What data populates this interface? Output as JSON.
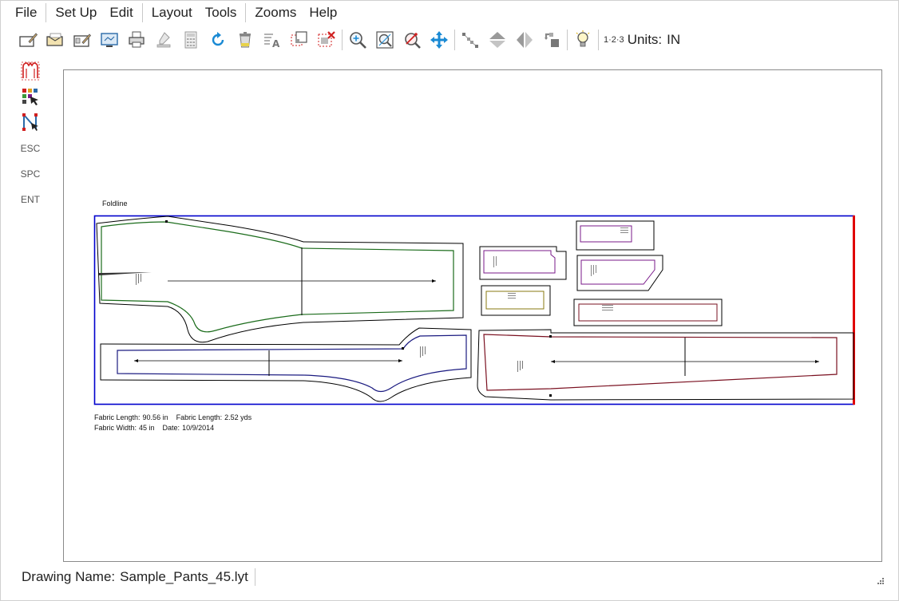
{
  "menu": {
    "items": [
      "File",
      "Set Up",
      "Edit",
      "Layout",
      "Tools",
      "Zooms",
      "Help"
    ]
  },
  "toolbar": {
    "icons": [
      "new-drawing-icon",
      "open-icon",
      "edit-card-icon",
      "monitor-icon",
      "print-icon",
      "plotter-icon",
      "calculator-icon",
      "refresh-icon",
      "trash-icon",
      "text-icon",
      "select-box-icon",
      "delete-box-icon",
      "zoom-in-icon",
      "zoom-fit-icon",
      "zoom-out-icon",
      "pan-icon",
      "nodes-icon",
      "flip-vertical-icon",
      "flip-horizontal-icon",
      "rotate-icon",
      "hint-bulb-icon"
    ],
    "units_number_label": "1·2·3",
    "units_label": "Units:",
    "units_value": "IN"
  },
  "left_tools": {
    "icons": [
      "pattern-pieces-icon",
      "color-select-icon",
      "node-edit-icon"
    ],
    "keys": [
      "ESC",
      "SPC",
      "ENT"
    ]
  },
  "canvas": {
    "foldline_label": "Foldline",
    "fabric_length_in_label": "Fabric Length:",
    "fabric_length_in_value": "90.56 in",
    "fabric_length_yds_label": "Fabric Length:",
    "fabric_length_yds_value": "2.52 yds",
    "fabric_width_label": "Fabric Width:",
    "fabric_width_value": "45 in",
    "date_label": "Date:",
    "date_value": "10/9/2014",
    "colors": {
      "border_blue": "#0000cc",
      "fold_red": "#e00000",
      "piece_green": "#1a6b1a",
      "piece_navy": "#1a1a80",
      "piece_purple": "#7a1a8a",
      "piece_olive": "#8a7a10",
      "piece_maroon": "#7a1020"
    }
  },
  "status": {
    "drawing_name_label": "Drawing Name:",
    "drawing_name_value": "Sample_Pants_45.lyt"
  }
}
